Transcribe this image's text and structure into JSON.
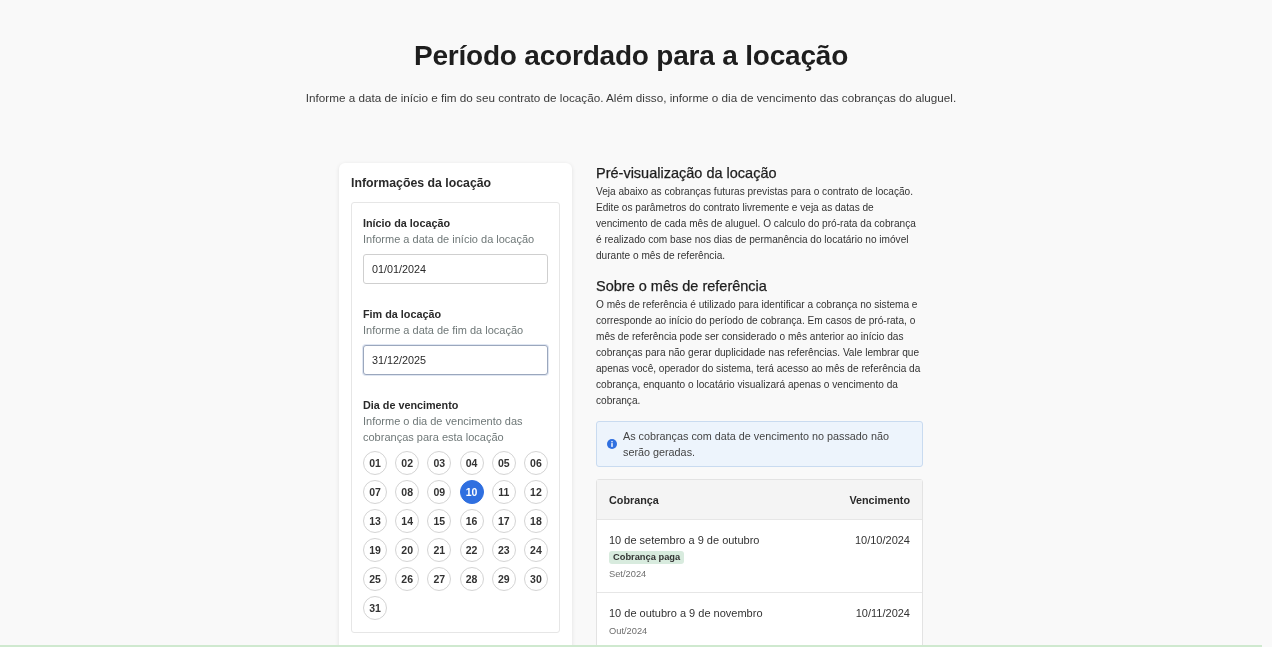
{
  "header": {
    "title": "Período acordado para a locação",
    "subtitle": "Informe a data de início e fim do seu contrato de locação. Além disso, informe o dia de vencimento das cobranças do aluguel."
  },
  "form": {
    "title": "Informações da locação",
    "fields": [
      {
        "label": "Início da locação",
        "hint": "Informe a data de início da locação",
        "value": "01/01/2024",
        "focused": false
      },
      {
        "label": "Fim da locação",
        "hint": "Informe a data de fim da locação",
        "value": "31/12/2025",
        "focused": true
      }
    ],
    "due_day": {
      "label": "Dia de vencimento",
      "hint": "Informe o dia de vencimento das cobranças para esta locação",
      "days": [
        {
          "label": "01",
          "selected": false
        },
        {
          "label": "02",
          "selected": false
        },
        {
          "label": "03",
          "selected": false
        },
        {
          "label": "04",
          "selected": false
        },
        {
          "label": "05",
          "selected": false
        },
        {
          "label": "06",
          "selected": false
        },
        {
          "label": "07",
          "selected": false
        },
        {
          "label": "08",
          "selected": false
        },
        {
          "label": "09",
          "selected": false
        },
        {
          "label": "10",
          "selected": true
        },
        {
          "label": "11",
          "selected": false
        },
        {
          "label": "12",
          "selected": false
        },
        {
          "label": "13",
          "selected": false
        },
        {
          "label": "14",
          "selected": false
        },
        {
          "label": "15",
          "selected": false
        },
        {
          "label": "16",
          "selected": false
        },
        {
          "label": "17",
          "selected": false
        },
        {
          "label": "18",
          "selected": false
        },
        {
          "label": "19",
          "selected": false
        },
        {
          "label": "20",
          "selected": false
        },
        {
          "label": "21",
          "selected": false
        },
        {
          "label": "22",
          "selected": false
        },
        {
          "label": "23",
          "selected": false
        },
        {
          "label": "24",
          "selected": false
        },
        {
          "label": "25",
          "selected": false
        },
        {
          "label": "26",
          "selected": false
        },
        {
          "label": "27",
          "selected": false
        },
        {
          "label": "28",
          "selected": false
        },
        {
          "label": "29",
          "selected": false
        },
        {
          "label": "30",
          "selected": false
        },
        {
          "label": "31",
          "selected": false
        }
      ]
    }
  },
  "preview": {
    "sections": [
      {
        "heading": "Pré-visualização da locação",
        "text": "Veja abaixo as cobranças futuras previstas para o contrato de locação. Edite os parâmetros do contrato livremente e veja as datas de vencimento de cada mês de aluguel. O calculo do pró-rata da cobrança é realizado com base nos dias de permanência do locatário no imóvel durante o mês de referência."
      },
      {
        "heading": "Sobre o mês de referência",
        "text": "O mês de referência é utilizado para identificar a cobrança no sistema e corresponde ao início do período de cobrança. Em casos de pró-rata, o mês de referência pode ser considerado o mês anterior ao início das cobranças para não gerar duplicidade nas referências. Vale lembrar que apenas você, operador do sistema, terá acesso ao mês de referência da cobrança, enquanto o locatário visualizará apenas o vencimento da cobrança."
      }
    ],
    "alert": {
      "text": "As cobranças com data de vencimento no passado não serão geradas."
    },
    "table": {
      "columns": [
        "Cobrança",
        "Vencimento"
      ],
      "rows": [
        {
          "period": "10 de setembro a 9 de outubro",
          "badge": "Cobrança paga",
          "reference": "Set/2024",
          "due_date": "10/10/2024"
        },
        {
          "period": "10 de outubro a 9 de novembro",
          "reference": "Out/2024",
          "due_date": "10/11/2024"
        }
      ]
    }
  }
}
